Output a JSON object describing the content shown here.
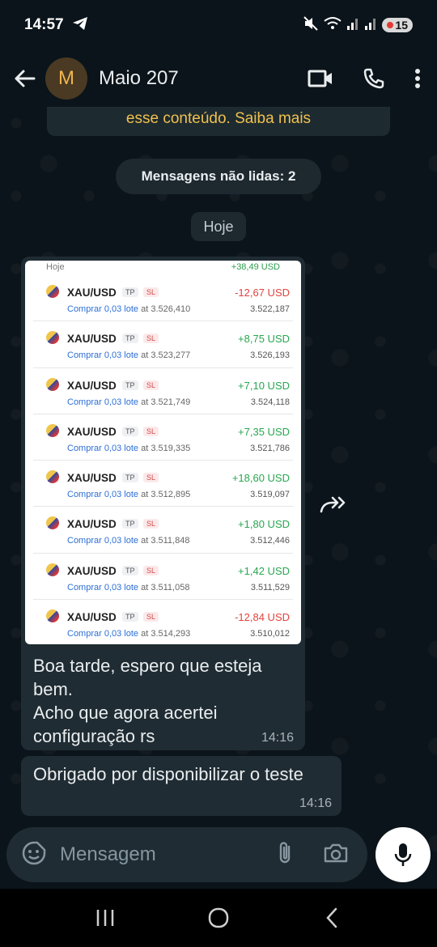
{
  "status": {
    "time": "14:57",
    "battery": "15"
  },
  "header": {
    "avatar_letter": "M",
    "contact_name": "Maio 207"
  },
  "chat": {
    "encryption_text": "esse conteúdo. Saiba mais",
    "unread_label": "Mensagens não lidas: 2",
    "day_label": "Hoje",
    "screenshot": {
      "head_label": "Hoje",
      "head_total": "+38,49 USD",
      "trades": [
        {
          "symbol": "XAU/USD",
          "tp": "TP",
          "sl": "SL",
          "pnl": "-12,67 USD",
          "sign": "neg",
          "action": "Comprar 0,03 lote",
          "at": "at 3.526,410",
          "price": "3.522,187"
        },
        {
          "symbol": "XAU/USD",
          "tp": "TP",
          "sl": "SL",
          "pnl": "+8,75 USD",
          "sign": "pos",
          "action": "Comprar 0,03 lote",
          "at": "at 3.523,277",
          "price": "3.526,193"
        },
        {
          "symbol": "XAU/USD",
          "tp": "TP",
          "sl": "SL",
          "pnl": "+7,10 USD",
          "sign": "pos",
          "action": "Comprar 0,03 lote",
          "at": "at 3.521,749",
          "price": "3.524,118"
        },
        {
          "symbol": "XAU/USD",
          "tp": "TP",
          "sl": "SL",
          "pnl": "+7,35 USD",
          "sign": "pos",
          "action": "Comprar 0,03 lote",
          "at": "at 3.519,335",
          "price": "3.521,786"
        },
        {
          "symbol": "XAU/USD",
          "tp": "TP",
          "sl": "SL",
          "pnl": "+18,60 USD",
          "sign": "pos",
          "action": "Comprar 0,03 lote",
          "at": "at 3.512,895",
          "price": "3.519,097"
        },
        {
          "symbol": "XAU/USD",
          "tp": "TP",
          "sl": "SL",
          "pnl": "+1,80 USD",
          "sign": "pos",
          "action": "Comprar 0,03 lote",
          "at": "at 3.511,848",
          "price": "3.512,446"
        },
        {
          "symbol": "XAU/USD",
          "tp": "TP",
          "sl": "SL",
          "pnl": "+1,42 USD",
          "sign": "pos",
          "action": "Comprar 0,03 lote",
          "at": "at 3.511,058",
          "price": "3.511,529"
        },
        {
          "symbol": "XAU/USD",
          "tp": "TP",
          "sl": "SL",
          "pnl": "-12,84 USD",
          "sign": "neg",
          "action": "Comprar 0,03 lote",
          "at": "at 3.514,293",
          "price": "3.510,012"
        }
      ]
    },
    "caption_lines": [
      "Boa tarde, espero que esteja",
      "bem.",
      "Acho que agora acertei",
      "configuração rs"
    ],
    "caption_time": "14:16",
    "message2": "Obrigado por disponibilizar o teste",
    "message2_time": "14:16"
  },
  "input": {
    "placeholder": "Mensagem"
  },
  "colors": {
    "accent_yellow": "#f0c04d",
    "bubble": "#202c33",
    "background": "#0b141a"
  }
}
